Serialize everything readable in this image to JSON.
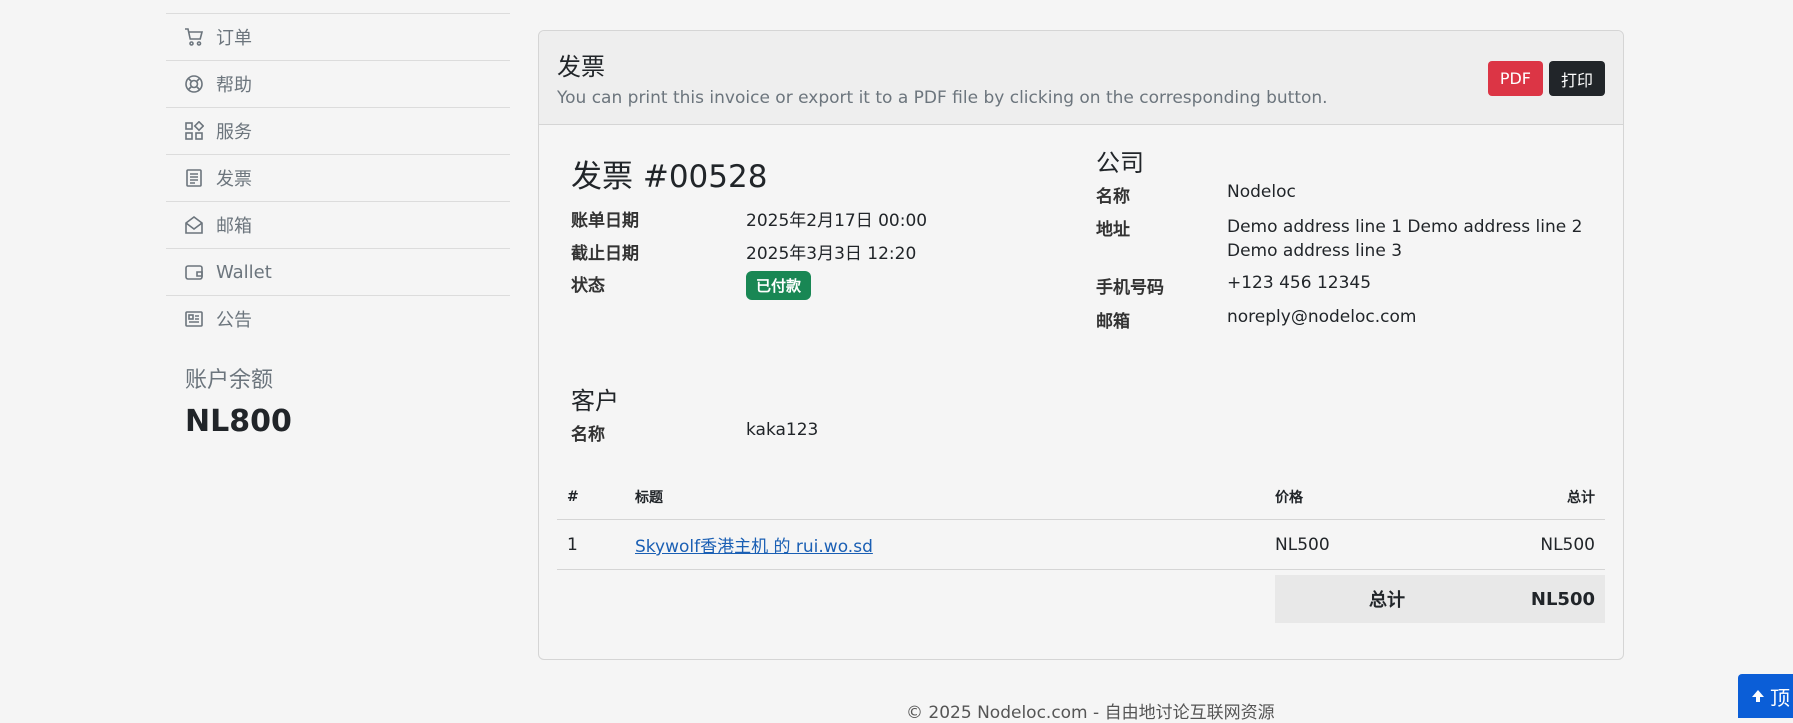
{
  "sidebar": {
    "items": [
      {
        "label": "订单",
        "icon": "cart-icon"
      },
      {
        "label": "帮助",
        "icon": "lifebuoy-icon"
      },
      {
        "label": "服务",
        "icon": "grid-icon"
      },
      {
        "label": "发票",
        "icon": "receipt-icon"
      },
      {
        "label": "邮箱",
        "icon": "envelope-open-icon"
      },
      {
        "label": "Wallet",
        "icon": "wallet-icon"
      },
      {
        "label": "公告",
        "icon": "newspaper-icon"
      }
    ],
    "balance_label": "账户余额",
    "balance_value": "NL800"
  },
  "card": {
    "title": "发票",
    "subtitle": "You can print this invoice or export it to a PDF file by clicking on the corresponding button.",
    "pdf_label": "PDF",
    "print_label": "打印"
  },
  "invoice": {
    "title": "发票 #00528",
    "bill_date_label": "账单日期",
    "bill_date": "2025年2月17日 00:00",
    "due_date_label": "截止日期",
    "due_date": "2025年3月3日 12:20",
    "status_label": "状态",
    "status": "已付款"
  },
  "company": {
    "title": "公司",
    "name_label": "名称",
    "name": "Nodeloc",
    "address_label": "地址",
    "address_line1": "Demo address line 1 Demo address line 2",
    "address_line2": "Demo address line 3",
    "phone_label": "手机号码",
    "phone": "+123 456 12345",
    "email_label": "邮箱",
    "email": "noreply@nodeloc.com"
  },
  "customer": {
    "title": "客户",
    "name_label": "名称",
    "name": "kaka123"
  },
  "table": {
    "headers": [
      "#",
      "标题",
      "价格",
      "总计"
    ],
    "rows": [
      {
        "num": "1",
        "title": "Skywolf香港主机 的 rui.wo.sd",
        "price": "NL500",
        "total": "NL500"
      }
    ],
    "total_label": "总计",
    "total_value": "NL500"
  },
  "footer": {
    "text": "© 2025 Nodeloc.com - 自由地讨论互联网资源"
  },
  "top_button": {
    "label": "顶"
  },
  "colors": {
    "pdf": "#dc3545",
    "print": "#212529",
    "status": "#198754",
    "link": "#1a5fb4",
    "top_button": "#0b5ed7"
  }
}
